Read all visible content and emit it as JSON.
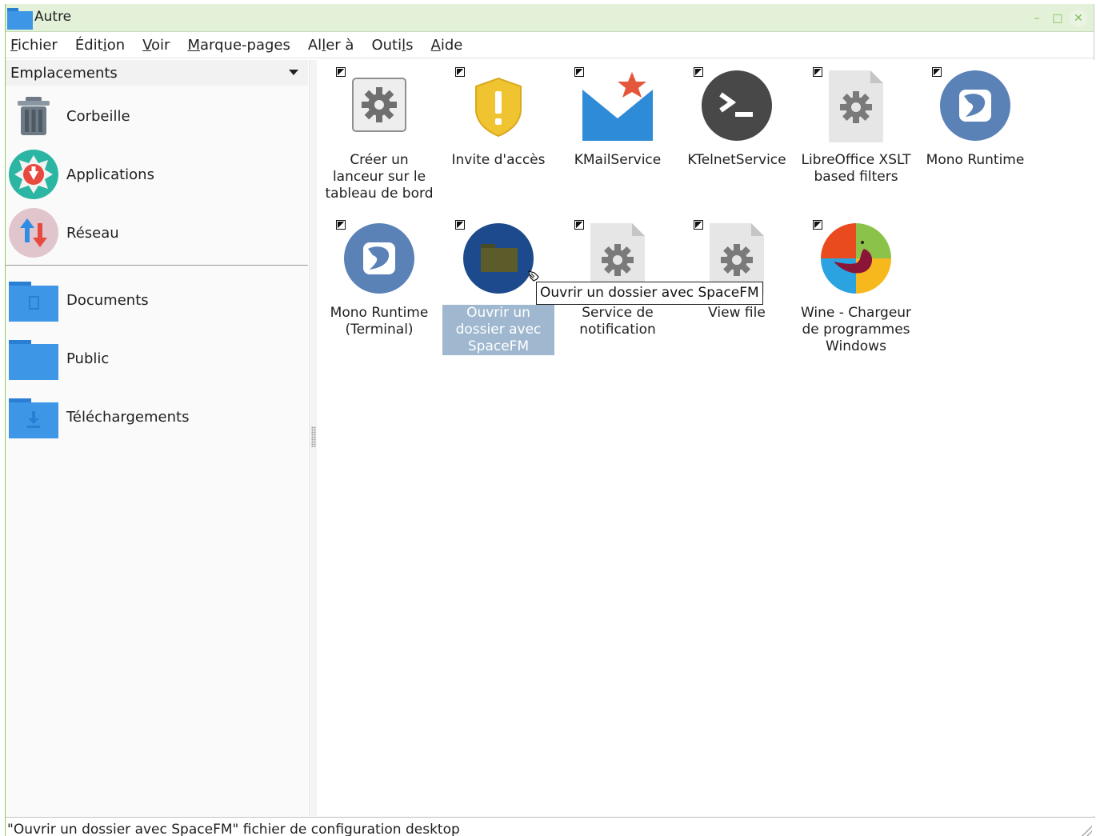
{
  "window": {
    "title": "Autre"
  },
  "menubar": {
    "items": [
      {
        "label": "Fichier",
        "mnemonic_index": 0
      },
      {
        "label": "Édition",
        "mnemonic_index": 4
      },
      {
        "label": "Voir",
        "mnemonic_index": 0
      },
      {
        "label": "Marque-pages",
        "mnemonic_index": 0
      },
      {
        "label": "Aller à",
        "mnemonic_index": 2
      },
      {
        "label": "Outils",
        "mnemonic_index": 4
      },
      {
        "label": "Aide",
        "mnemonic_index": 0
      }
    ]
  },
  "sidebar": {
    "header": "Emplacements",
    "places": [
      {
        "label": "Corbeille",
        "icon": "trash-icon"
      },
      {
        "label": "Applications",
        "icon": "applications-icon"
      },
      {
        "label": "Réseau",
        "icon": "network-icon"
      }
    ],
    "bookmarks": [
      {
        "label": "Documents",
        "icon": "documents-folder-icon"
      },
      {
        "label": "Public",
        "icon": "public-folder-icon"
      },
      {
        "label": "Téléchargements",
        "icon": "downloads-folder-icon"
      }
    ]
  },
  "files": [
    {
      "name": "Créer un lanceur sur le tableau de bord",
      "icon": "launcher-gear-icon",
      "selected": false
    },
    {
      "name": "Invite d'accès",
      "icon": "access-prompt-shield-icon",
      "selected": false
    },
    {
      "name": "KMailService",
      "icon": "kmail-envelope-icon",
      "selected": false
    },
    {
      "name": "KTelnetService",
      "icon": "terminal-icon",
      "selected": false
    },
    {
      "name": "LibreOffice XSLT based filters",
      "icon": "gear-document-icon",
      "selected": false
    },
    {
      "name": "Mono Runtime",
      "icon": "mono-icon",
      "selected": false
    },
    {
      "name": "Mono Runtime (Terminal)",
      "icon": "mono-icon",
      "selected": false
    },
    {
      "name": "Ouvrir un dossier avec SpaceFM",
      "icon": "spacefm-folder-icon",
      "selected": true
    },
    {
      "name": "Service de notification",
      "icon": "gear-document-icon",
      "selected": false
    },
    {
      "name": "View file",
      "icon": "gear-document-icon",
      "selected": false
    },
    {
      "name": "Wine - Chargeur de programmes Windows",
      "icon": "wine-icon",
      "selected": false
    }
  ],
  "tooltip": {
    "text": "Ouvrir un dossier avec SpaceFM"
  },
  "statusbar": {
    "text": "\"Ouvrir un dossier avec SpaceFM\" fichier de configuration desktop"
  },
  "colors": {
    "accent": "#8cc46a",
    "selection": "#9fb8cf",
    "folder": "#3d96e6"
  }
}
